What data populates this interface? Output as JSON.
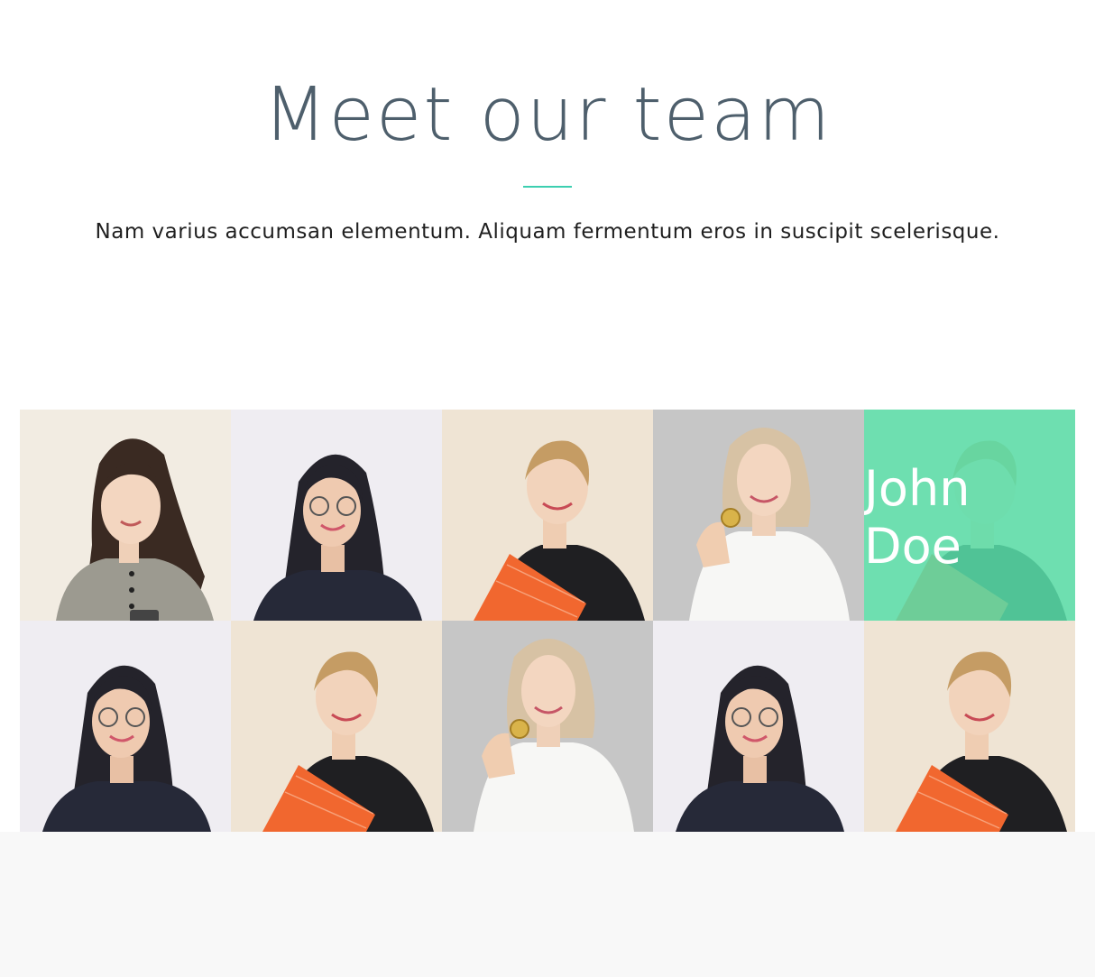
{
  "section": {
    "title": "Meet our team",
    "subtitle": "Nam varius accumsan elementum. Aliquam fermentum eros in suscipit scelerisque.",
    "divider_color": "#3ccfb0"
  },
  "team": {
    "highlight_color": "#58deaa",
    "hovered_member": {
      "name": "John Doe"
    },
    "photos": [
      {
        "person": "long-dark-hair-gray-shirt-phone",
        "background": "#f2ece2"
      },
      {
        "person": "glasses-dark-wavy-hair-navy-sweater",
        "background": "#efedf2"
      },
      {
        "person": "blonde-bun-black-top-orange-folder",
        "background": "#efe4d4"
      },
      {
        "person": "blonde-bob-white-shirt-coin",
        "background": "#c6c6c6"
      },
      {
        "person": "blonde-bun-black-top-orange-folder",
        "background": "#efe4d4"
      },
      {
        "person": "glasses-dark-wavy-hair-navy-sweater",
        "background": "#efedf2"
      },
      {
        "person": "blonde-bun-black-top-orange-folder",
        "background": "#efe4d4"
      },
      {
        "person": "blonde-bob-white-shirt-coin",
        "background": "#c6c6c6"
      },
      {
        "person": "glasses-dark-wavy-hair-navy-sweater",
        "background": "#efedf2"
      },
      {
        "person": "blonde-bun-black-top-orange-folder",
        "background": "#efe4d4"
      }
    ]
  }
}
